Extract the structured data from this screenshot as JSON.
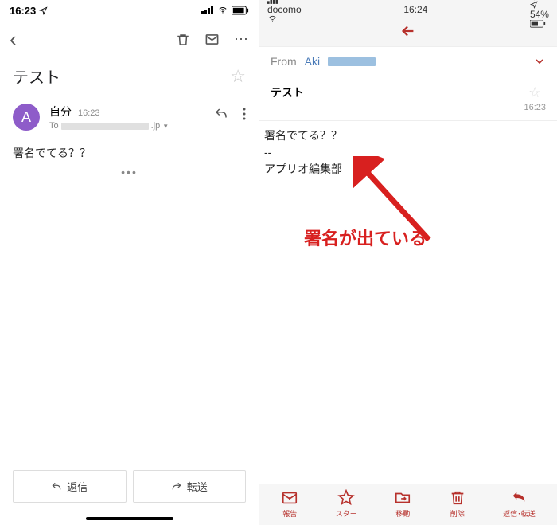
{
  "left": {
    "status": {
      "time": "16:23",
      "loc_icon": "location"
    },
    "toolbar": {
      "back": "‹",
      "delete": "trash",
      "archive": "mail",
      "more": "⋯"
    },
    "subject": "テスト",
    "avatar_letter": "A",
    "sender_name": "自分",
    "sender_time": "16:23",
    "sender_to_prefix": "To",
    "sender_to_suffix": ".jp",
    "body": "署名でてる？？",
    "dots": "•••",
    "reply_label": "返信",
    "forward_label": "転送"
  },
  "right": {
    "status": {
      "carrier": "docomo",
      "time": "16:24",
      "battery": "54%"
    },
    "from_label": "From",
    "from_name": "Aki",
    "subject": "テスト",
    "time": "16:23",
    "body_line1": "署名でてる？？",
    "body_sep": "--",
    "body_line2": "アプリオ編集部",
    "annotation": "署名が出ている",
    "bottom": {
      "report": "報告",
      "star": "スター",
      "move": "移動",
      "delete": "削除",
      "reply": "返信･転送"
    }
  }
}
